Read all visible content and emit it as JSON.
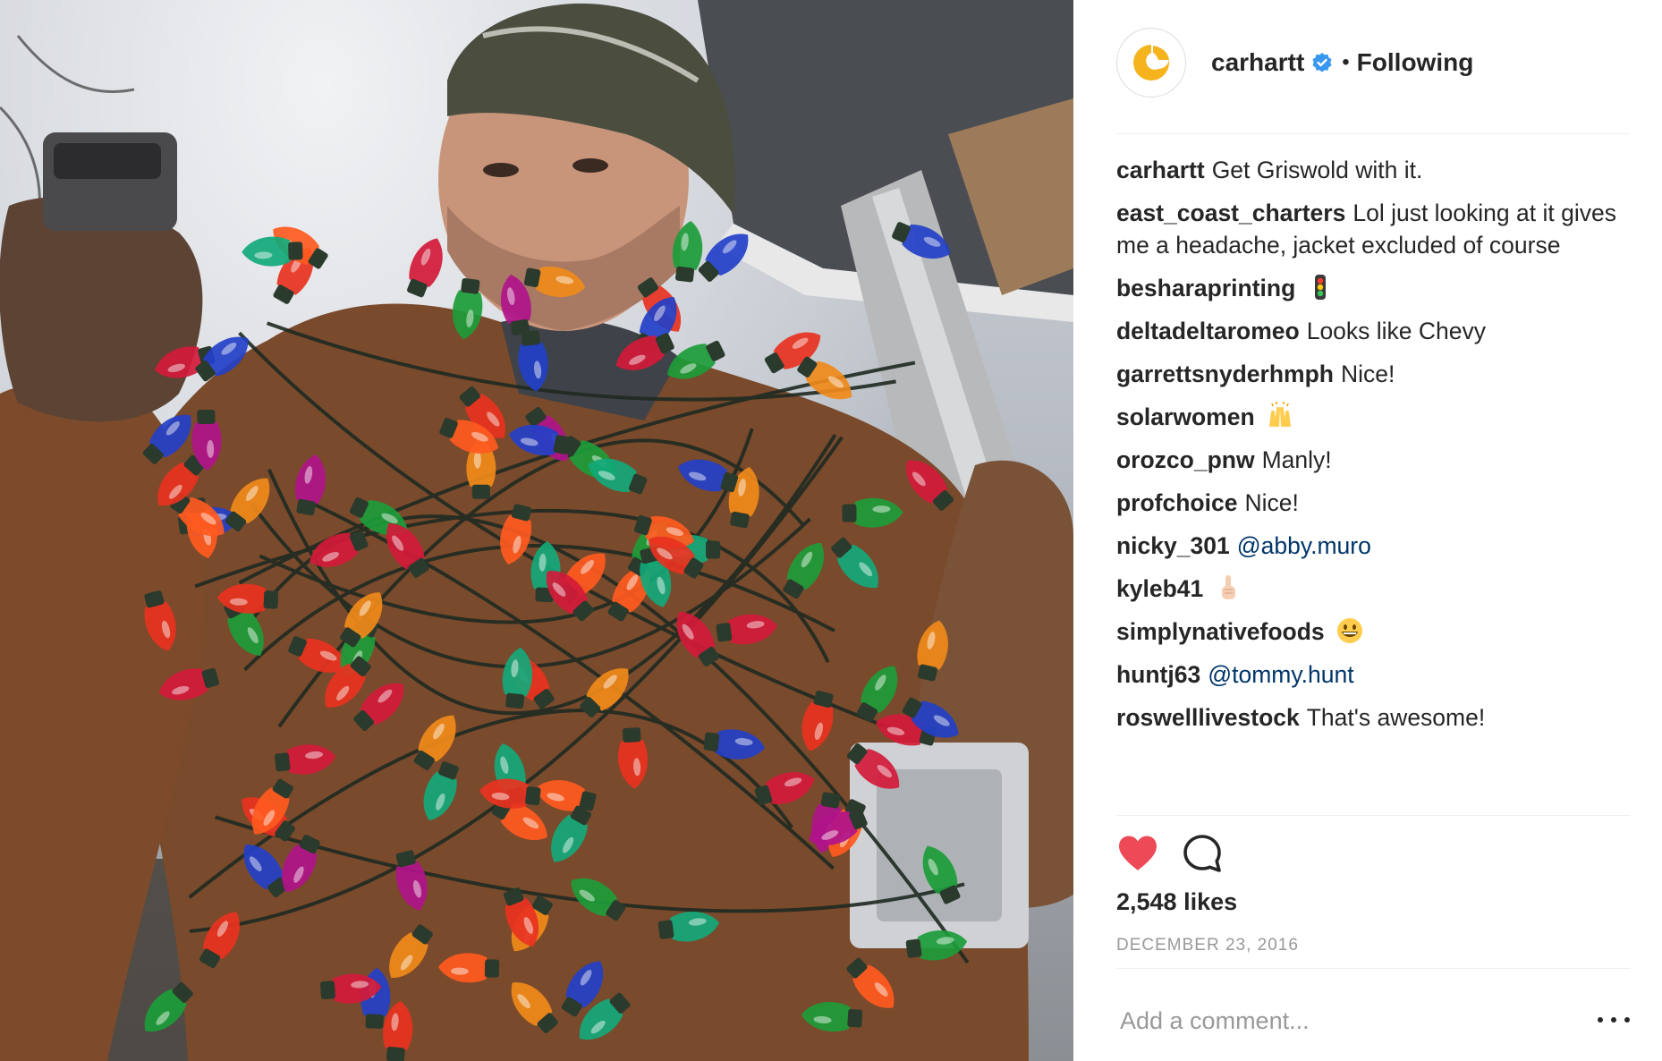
{
  "post": {
    "author": "carhartt",
    "follow_state": "Following",
    "separator": "•",
    "photo_alt": "Man in a beanie and brown work jacket holding a staple gun, wrapped in strands of colorful Christmas lights, carrying a ladder"
  },
  "comments": [
    {
      "user": "carhartt",
      "text": "Get Griswold with it."
    },
    {
      "user": "east_coast_charters",
      "text": "Lol just looking at it gives me a headache, jacket excluded of course"
    },
    {
      "user": "besharaprinting",
      "text": "",
      "emoji": "traffic-light-icon"
    },
    {
      "user": "deltadeltaromeo",
      "text": "Looks like Chevy"
    },
    {
      "user": "garrettsnyderhmph",
      "text": "Nice!"
    },
    {
      "user": "solarwomen",
      "text": "",
      "emoji": "raising-hands-icon"
    },
    {
      "user": "orozco_pnw",
      "text": "Manly!"
    },
    {
      "user": "profchoice",
      "text": "Nice!"
    },
    {
      "user": "nicky_301",
      "mention": "@abby.muro"
    },
    {
      "user": "kyleb41",
      "text": "",
      "emoji": "pointing-up-icon"
    },
    {
      "user": "simplynativefoods",
      "text": "",
      "emoji": "grinning-face-icon"
    },
    {
      "user": "huntj63",
      "mention": "@tommy.hunt"
    },
    {
      "user": "roswelllivestock",
      "text": "That's awesome!"
    }
  ],
  "stats": {
    "likes": "2,548 likes",
    "date": "DECEMBER 23, 2016"
  },
  "composer": {
    "placeholder": "Add a comment..."
  },
  "colors": {
    "like_red": "#ed4956",
    "verified_blue": "#3897f0",
    "brand_yellow": "#f5b41e",
    "mention_blue": "#003569",
    "muted_gray": "#999999"
  }
}
